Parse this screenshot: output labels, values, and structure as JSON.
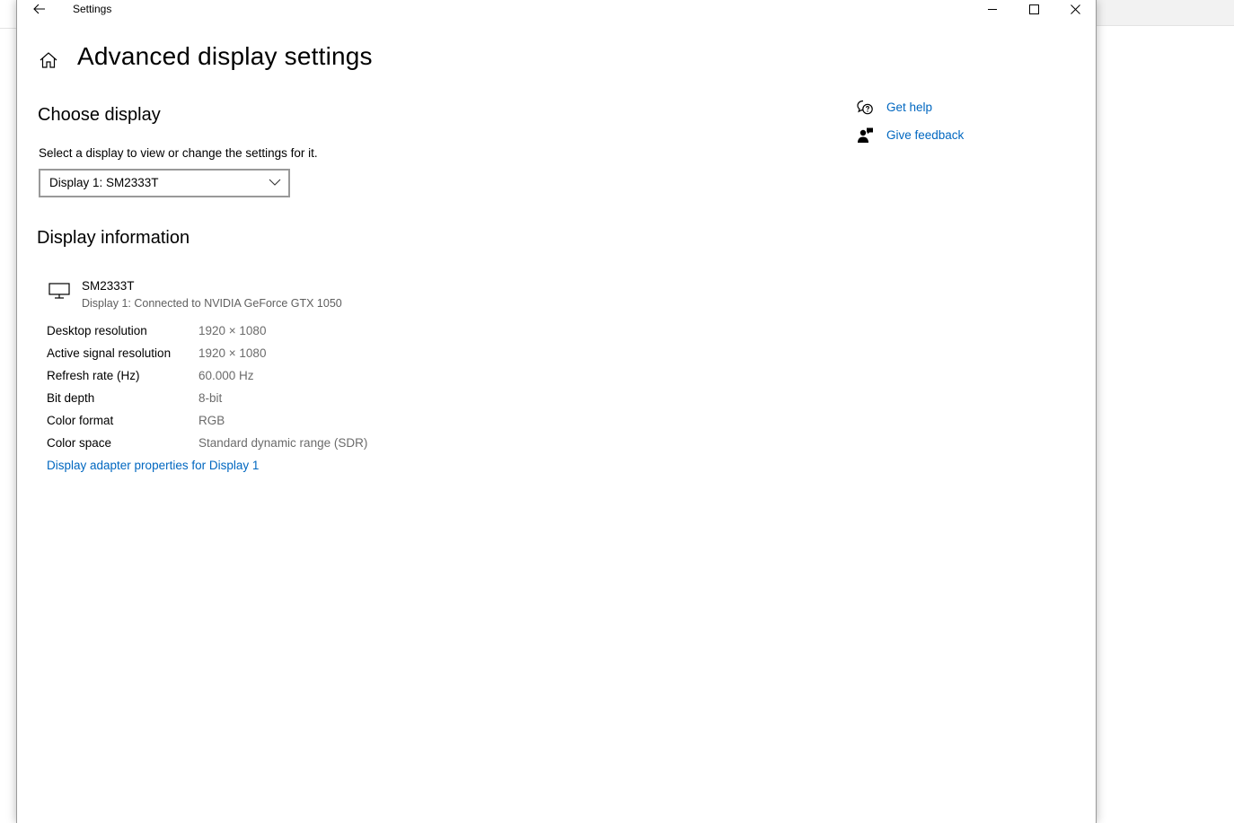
{
  "window": {
    "title": "Settings"
  },
  "page": {
    "title": "Advanced display settings"
  },
  "choose_display": {
    "heading": "Choose display",
    "description": "Select a display to view or change the settings for it.",
    "selected": "Display 1: SM2333T"
  },
  "display_info": {
    "heading": "Display information",
    "monitor_name": "SM2333T",
    "connection": "Display 1: Connected to NVIDIA GeForce GTX 1050",
    "rows": [
      {
        "label": "Desktop resolution",
        "value": "1920 × 1080"
      },
      {
        "label": "Active signal resolution",
        "value": "1920 × 1080"
      },
      {
        "label": "Refresh rate (Hz)",
        "value": "60.000 Hz"
      },
      {
        "label": "Bit depth",
        "value": "8-bit"
      },
      {
        "label": "Color format",
        "value": "RGB"
      },
      {
        "label": "Color space",
        "value": "Standard dynamic range (SDR)"
      }
    ],
    "adapter_link": "Display adapter properties for Display 1"
  },
  "help": {
    "get_help": "Get help",
    "give_feedback": "Give feedback"
  },
  "colors": {
    "link": "#0067c0",
    "secondary_text": "#6b6b6b"
  }
}
